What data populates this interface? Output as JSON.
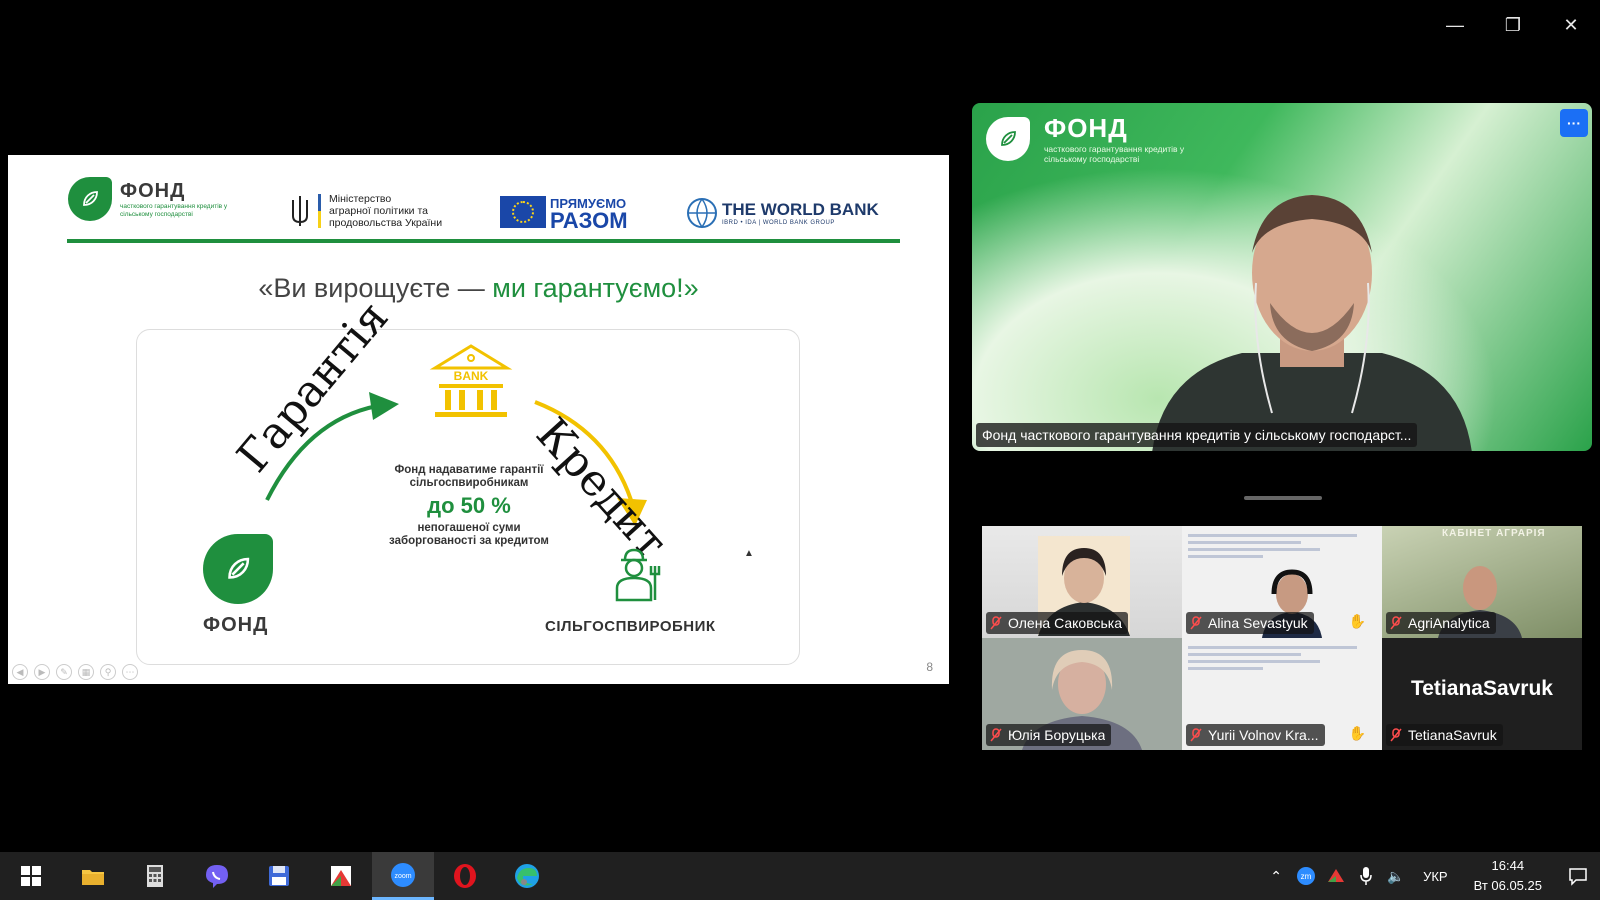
{
  "window": {
    "minimize": "—",
    "restore": "❐",
    "close": "✕"
  },
  "slide": {
    "fond_logo": {
      "title": "ФОНД",
      "subtitle": "часткового гарантування кредитів у сільському господарстві"
    },
    "ministry_logo": {
      "text_l1": "Міністерство",
      "text_l2": "аграрної політики та",
      "text_l3": "продовольства України"
    },
    "eu_logo": {
      "line1": "ПРЯМУЄМО",
      "line2": "РАЗОМ"
    },
    "worldbank_logo": {
      "line1": "THE WORLD BANK",
      "line2": "IBRD • IDA | WORLD BANK GROUP"
    },
    "slogan_part1": "«Ви вирощуєте — ",
    "slogan_part2": "ми гарантуємо!»",
    "diagram": {
      "bank_label": "BANK",
      "guarantee_word": "Гарантія",
      "credit_word": "Кредит",
      "center_l1": "Фонд надаватиме гарантії сільгоспвиробникам",
      "center_l2": "до 50 %",
      "center_l3": "непогашеної суми заборгованості за кредитом",
      "fond_label": "ФОНД",
      "farmer_label": "СІЛЬГОСПВИРОБНИК"
    },
    "page_number": "8"
  },
  "speaker": {
    "logo_title": "ФОНД",
    "logo_subtitle": "часткового гарантування кредитів у сільському господарстві",
    "more_label": "···",
    "name": "Фонд часткового гарантування кредитів у сільському господарст..."
  },
  "participants": [
    {
      "name": "Олена Саковська"
    },
    {
      "name": "Alina Sevastyuk"
    },
    {
      "name": "AgriAnalytica"
    },
    {
      "name": "Юлія Боруцька"
    },
    {
      "name": "Yurii Volnov Kra..."
    },
    {
      "name": "TetianaSavruk",
      "display": "TetianaSavruk"
    }
  ],
  "agrarian_poster_title": "КАБІНЕТ АГРАРІЯ",
  "taskbar": {
    "lang": "УКР",
    "time": "16:44",
    "date": "Вт 06.05.25"
  },
  "colors": {
    "brand_green": "#1f8f3e",
    "zoom_blue": "#1b6ff5",
    "bank_yellow": "#f2c200"
  }
}
